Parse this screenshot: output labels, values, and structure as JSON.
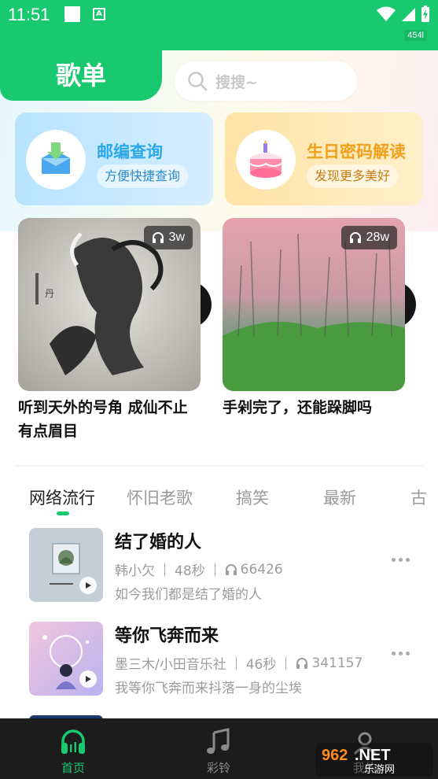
{
  "status": {
    "time": "11:51",
    "net_speed": "454l"
  },
  "header": {
    "title": "歌单",
    "search_placeholder": "搜搜~"
  },
  "cards": [
    {
      "title": "邮编查询",
      "subtitle": "方便快捷查询",
      "icon": "mailbox-icon"
    },
    {
      "title": "生日密码解读",
      "subtitle": "发现更多美好",
      "icon": "birthday-cake-icon"
    }
  ],
  "albums": [
    {
      "title_line1": "听到天外的号角 成仙不止",
      "title_line2": "有点眉目",
      "plays": "3w"
    },
    {
      "title_line1": "手剁完了，还能跺脚吗",
      "title_line2": "",
      "plays": "28w"
    }
  ],
  "tabs": [
    "网络流行",
    "怀旧老歌",
    "搞笑",
    "最新",
    "古"
  ],
  "active_tab": 0,
  "songs": [
    {
      "title": "结了婚的人",
      "artist": "韩小欠",
      "duration": "48秒",
      "plays": "66426",
      "desc": "如今我们都是结了婚的人"
    },
    {
      "title": "等你飞奔而来",
      "artist": "墨三木/小田音乐社",
      "duration": "46秒",
      "plays": "341157",
      "desc": "我等你飞奔而来抖落一身的尘埃"
    }
  ],
  "bottom_nav": [
    {
      "label": "首页",
      "icon": "headphones-icon",
      "active": true
    },
    {
      "label": "彩铃",
      "icon": "music-note-icon",
      "active": false
    },
    {
      "label": "我的",
      "icon": "profile-icon",
      "active": false
    }
  ],
  "watermark": "962.NET 乐游网",
  "colors": {
    "accent": "#19c96f",
    "nav_bg": "#1c1c1c",
    "card_blue": "#c4e8ff",
    "card_yellow": "#ffe8b2"
  }
}
